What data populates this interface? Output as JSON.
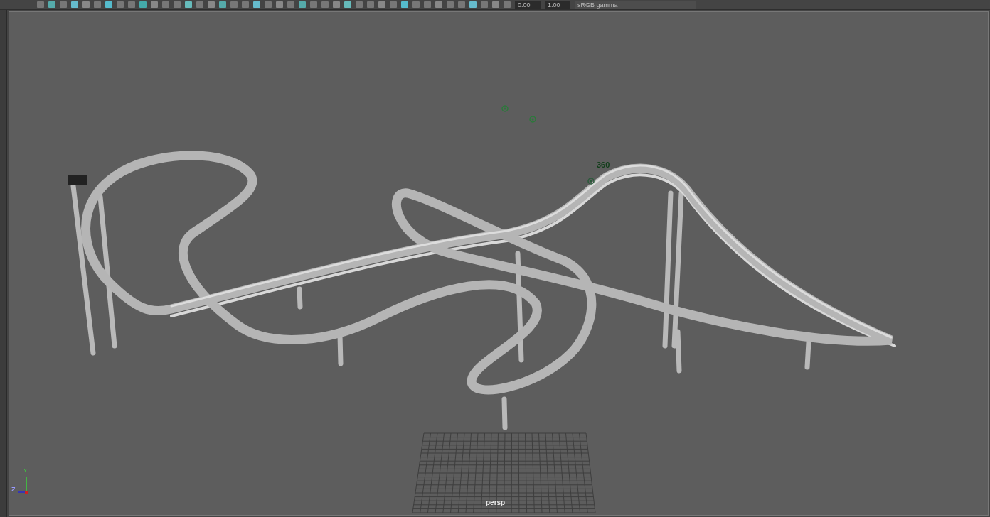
{
  "toolbar": {
    "exposure": "0.00",
    "gamma": "1.00",
    "color_space": "sRGB gamma"
  },
  "viewport": {
    "markers": [
      {
        "label": "360"
      }
    ],
    "axis": {
      "y": "Y",
      "z": "Z"
    },
    "camera_label": "persp"
  }
}
